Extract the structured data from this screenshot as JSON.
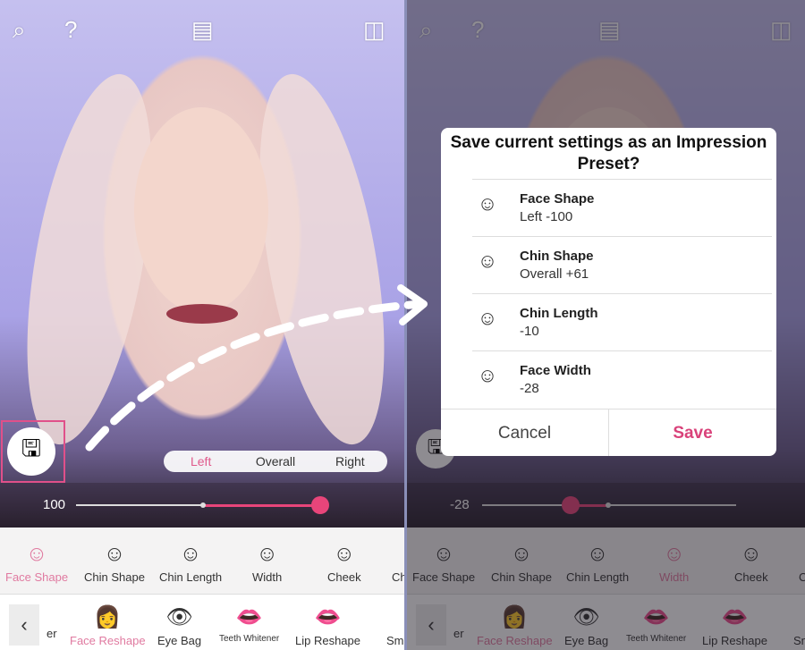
{
  "left": {
    "slider_value": "100",
    "segments": [
      "Left",
      "Overall",
      "Right"
    ],
    "active_segment": "Left",
    "subtools": [
      {
        "label": "Face Shape",
        "active": true
      },
      {
        "label": "Chin Shape"
      },
      {
        "label": "Chin Length"
      },
      {
        "label": "Width"
      },
      {
        "label": "Cheek"
      },
      {
        "label": "Ch"
      }
    ]
  },
  "right": {
    "slider_value": "-28",
    "subtools": [
      {
        "label": "Face Shape"
      },
      {
        "label": "Chin Shape"
      },
      {
        "label": "Chin Length"
      },
      {
        "label": "Width",
        "active": true
      },
      {
        "label": "Cheek"
      },
      {
        "label": "C"
      }
    ]
  },
  "tools": [
    {
      "label": "er"
    },
    {
      "label": "Face Reshape",
      "active": true
    },
    {
      "label": "Eye Bag"
    },
    {
      "label": "Teeth Whitener"
    },
    {
      "label": "Lip Reshape"
    },
    {
      "label": "Sm"
    }
  ],
  "dialog": {
    "title": "Save current settings as an Impression Preset?",
    "items": [
      {
        "name": "Face Shape",
        "value": "Left -100"
      },
      {
        "name": "Chin Shape",
        "value": "Overall +61"
      },
      {
        "name": "Chin Length",
        "value": "-10"
      },
      {
        "name": "Face Width",
        "value": "-28"
      }
    ],
    "cancel": "Cancel",
    "save": "Save"
  },
  "colors": {
    "accent": "#e8457a",
    "highlight": "#e0508a"
  }
}
